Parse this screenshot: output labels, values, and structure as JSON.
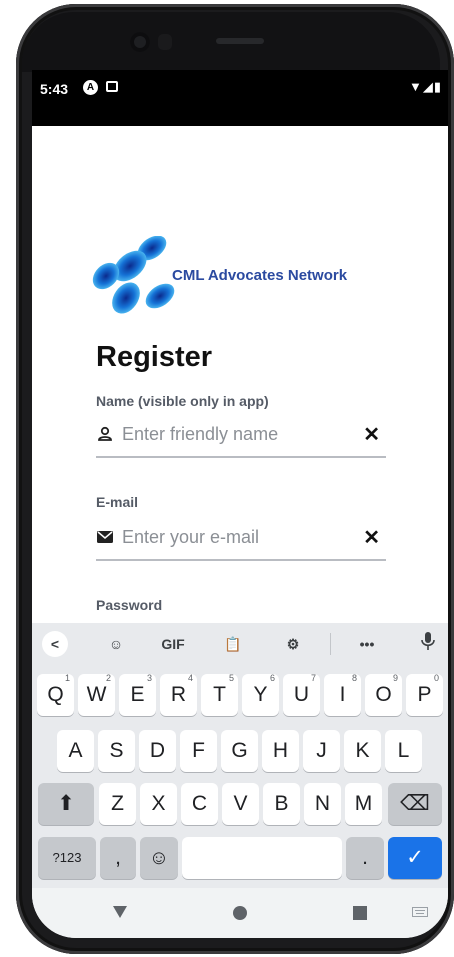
{
  "status": {
    "time": "5:43",
    "right_icons": "▼◢▮"
  },
  "app": {
    "logo_text": "CML Advocates Network",
    "title": "Register"
  },
  "form": {
    "name_label": "Name (visible only in app)",
    "name_placeholder": "Enter friendly name",
    "email_label": "E-mail",
    "email_placeholder": "Enter your e-mail",
    "password_label": "Password"
  },
  "keyboard": {
    "toolbar": {
      "back": "<",
      "gif": "GIF",
      "more": "•••"
    },
    "row1": [
      {
        "k": "Q",
        "n": "1"
      },
      {
        "k": "W",
        "n": "2"
      },
      {
        "k": "E",
        "n": "3"
      },
      {
        "k": "R",
        "n": "4"
      },
      {
        "k": "T",
        "n": "5"
      },
      {
        "k": "Y",
        "n": "6"
      },
      {
        "k": "U",
        "n": "7"
      },
      {
        "k": "I",
        "n": "8"
      },
      {
        "k": "O",
        "n": "9"
      },
      {
        "k": "P",
        "n": "0"
      }
    ],
    "row2": [
      "A",
      "S",
      "D",
      "F",
      "G",
      "H",
      "J",
      "K",
      "L"
    ],
    "row3": [
      "Z",
      "X",
      "C",
      "V",
      "B",
      "N",
      "M"
    ],
    "symbols_label": "?123",
    "comma": ",",
    "period": "."
  },
  "colors": {
    "accent": "#1a73e8",
    "logo_blue": "#2b4aa0"
  }
}
